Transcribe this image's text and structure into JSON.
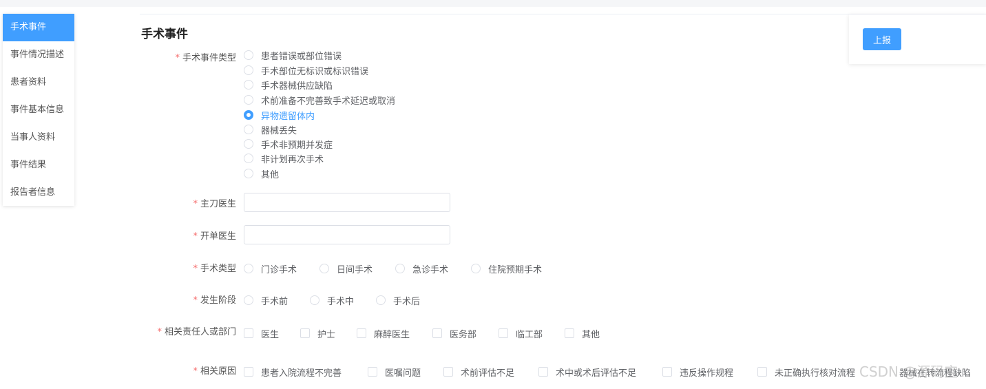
{
  "sidebar": {
    "items": [
      {
        "label": "手术事件",
        "active": true
      },
      {
        "label": "事件情况描述"
      },
      {
        "label": "患者资料"
      },
      {
        "label": "事件基本信息"
      },
      {
        "label": "当事人资料"
      },
      {
        "label": "事件结果"
      },
      {
        "label": "报告者信息"
      }
    ]
  },
  "report_button": "上报",
  "section_title": "手术事件",
  "required_mark": "*",
  "fields": {
    "event_type": {
      "label": "手术事件类型",
      "selected": "异物遗留体内",
      "options": [
        "患者错误或部位错误",
        "手术部位无标识或标识错误",
        "手术器械供应缺陷",
        "术前准备不完善致手术延迟或取消",
        "异物遗留体内",
        "器械丢失",
        "手术非预期并发症",
        "非计划再次手术",
        "其他"
      ]
    },
    "chief_surgeon": {
      "label": "主刀医生",
      "value": ""
    },
    "ordering_doctor": {
      "label": "开单医生",
      "value": ""
    },
    "surgery_type": {
      "label": "手术类型",
      "options": [
        "门诊手术",
        "日间手术",
        "急诊手术",
        "住院预期手术"
      ]
    },
    "stage": {
      "label": "发生阶段",
      "options": [
        "手术前",
        "手术中",
        "手术后"
      ]
    },
    "responsible": {
      "label": "相关责任人或部门",
      "options": [
        "医生",
        "护士",
        "麻醉医生",
        "医务部",
        "临工部",
        "其他"
      ]
    },
    "causes": {
      "label": "相关原因",
      "options": [
        "患者入院流程不完善",
        "医嘱问题",
        "术前评估不足",
        "术中或术后评估不足",
        "违反操作规程",
        "未正确执行核对流程",
        "器械在转流程缺陷"
      ]
    }
  },
  "watermark": "CSDN @源码宝",
  "colors": {
    "accent": "#409eff",
    "required": "#f56c6c"
  }
}
